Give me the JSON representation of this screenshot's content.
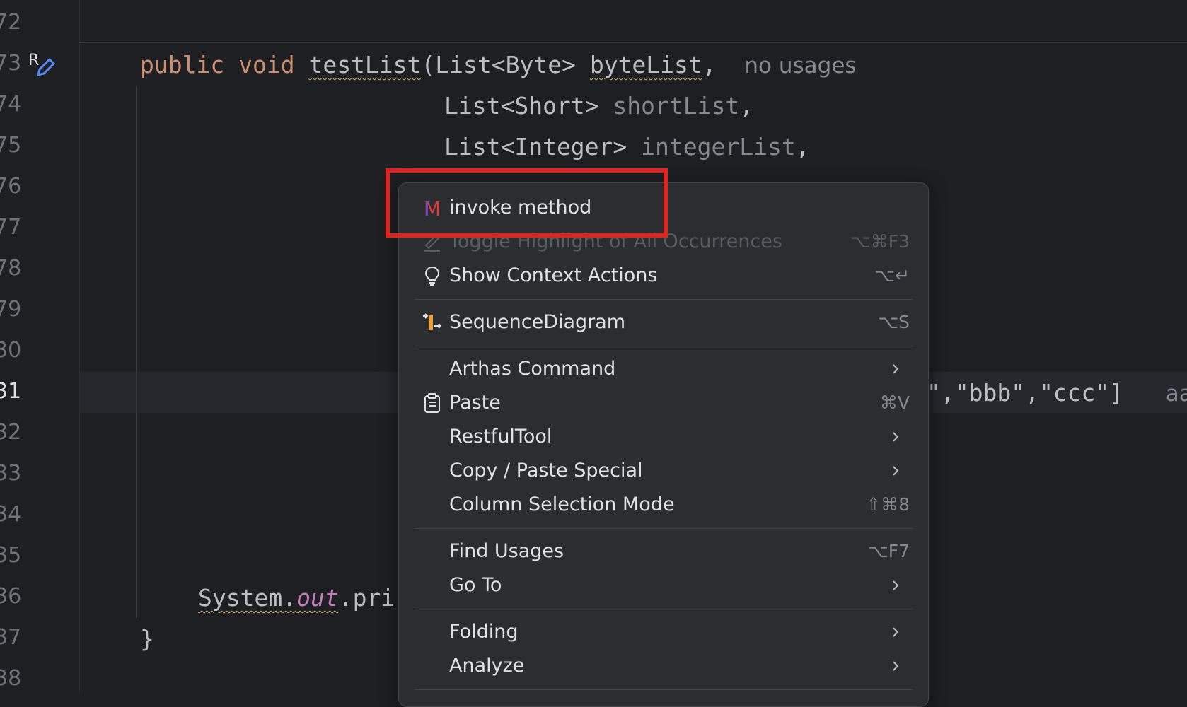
{
  "gutter": {
    "line_numbers": [
      "72",
      "73",
      "74",
      "75",
      "76",
      "77",
      "78",
      "79",
      "30",
      "31",
      "32",
      "33",
      "34",
      "35",
      "36",
      "37",
      "38"
    ],
    "current_line": "31"
  },
  "code": {
    "line73": {
      "kw_public": "public",
      "kw_void": "void",
      "method": "testList",
      "paren_type": "(List<Byte> ",
      "param": "byteList",
      "comma": ",",
      "hint": "no usages"
    },
    "line74": {
      "type": "List<Short> ",
      "param": "shortList",
      "comma": ","
    },
    "line75": {
      "type": "List<Integer> ",
      "param": "integerList",
      "comma": ","
    },
    "line31_tail": {
      "text": "\",\"bbb\",\"ccc\"]",
      "hint": "aa"
    },
    "line36": {
      "system": "System",
      "dot1": ".",
      "out": "out",
      "rest": ".pri"
    },
    "line37": {
      "brace": "}"
    }
  },
  "menu": {
    "invoke_method": {
      "label": "invoke method",
      "icon": "method-m-icon"
    },
    "toggle_highlight": {
      "label": "Toggle Highlight of All Occurrences",
      "shortcut": "⌥⌘F3"
    },
    "show_context_actions": {
      "label": "Show Context Actions",
      "shortcut": "⌥↵"
    },
    "sequence_diagram": {
      "label": "SequenceDiagram",
      "shortcut": "⌥S"
    },
    "arthas_command": {
      "label": "Arthas Command"
    },
    "paste": {
      "label": "Paste",
      "shortcut": "⌘V"
    },
    "restful_tool": {
      "label": "RestfulTool"
    },
    "copy_paste_special": {
      "label": "Copy / Paste Special"
    },
    "column_selection_mode": {
      "label": "Column Selection Mode",
      "shortcut": "⇧⌘8"
    },
    "find_usages": {
      "label": "Find Usages",
      "shortcut": "⌥F7"
    },
    "go_to": {
      "label": "Go To"
    },
    "folding": {
      "label": "Folding"
    },
    "analyze": {
      "label": "Analyze"
    }
  },
  "colors": {
    "editor_bg": "#1e1f22",
    "menu_bg": "#2b2d30",
    "keyword": "#cf8e6d",
    "annotation_box": "#e0231f"
  }
}
